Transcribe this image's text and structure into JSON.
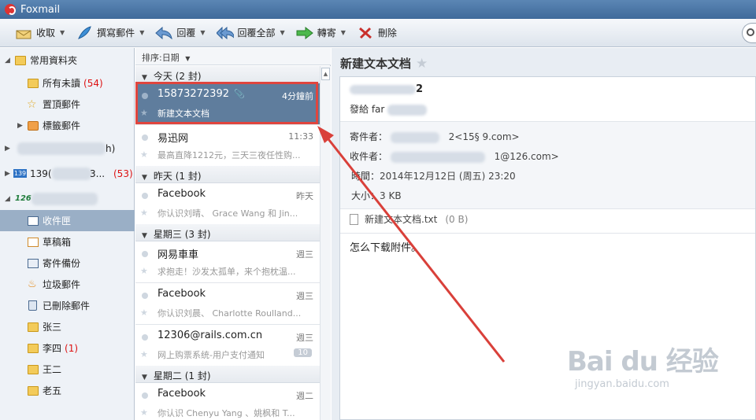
{
  "window": {
    "title": "Foxmail"
  },
  "toolbar": {
    "receive": "收取",
    "compose": "撰寫郵件",
    "reply": "回覆",
    "reply_all": "回覆全部",
    "forward": "轉寄",
    "delete": "刪除"
  },
  "sidebar": {
    "common_folder": "常用資料夾",
    "unread": "所有未讀",
    "unread_count": "(54)",
    "starred": "置頂郵件",
    "tags": "標籤郵件",
    "account1_suffix": "h)",
    "account2_prefix": "139(",
    "account2_mid": "3...",
    "account2_count": "(53)",
    "account3_prefix": "126",
    "inbox": "收件匣",
    "drafts": "草稿箱",
    "sent": "寄件備份",
    "junk": "垃圾郵件",
    "trash": "已刪除郵件",
    "folder_zhangsan": "张三",
    "folder_lisi": "李四",
    "folder_lisi_count": "(1)",
    "folder_wanger": "王二",
    "folder_laowu": "老五"
  },
  "list": {
    "sort_label": "排序:日期",
    "groups": [
      "今天 (2 封)",
      "昨天 (1 封)",
      "星期三 (3 封)",
      "星期二 (1 封)"
    ],
    "messages": [
      {
        "from": "15873272392",
        "time": "4分鐘前",
        "subject": "新建文本文档"
      },
      {
        "from": "易迅网",
        "time": "11:33",
        "subject": "最高直降1212元，三天三夜任性购..."
      },
      {
        "from": "Facebook",
        "time": "昨天",
        "subject": "你认识刘晴、 Grace Wang 和 Jin..."
      },
      {
        "from": "网易車車",
        "time": "週三",
        "subject": "求抱走！沙发太孤单，来个抱枕温..."
      },
      {
        "from": "Facebook",
        "time": "週三",
        "subject": "你认识刘晨、 Charlotte Roulland..."
      },
      {
        "from": "12306@rails.com.cn",
        "time": "週三",
        "subject": "网上购票系统-用户支付通知",
        "badge": "10"
      },
      {
        "from": "Facebook",
        "time": "週二",
        "subject": "你认识 Chenyu Yang 、姚枫和 T..."
      }
    ]
  },
  "reader": {
    "title": "新建文本文档",
    "from_name_suffix": "2",
    "send_by": "發給 far",
    "from_label": "寄件者：",
    "from_value": "2<15§                9.com>",
    "to_label": "收件者：",
    "to_value": "1@126.com>",
    "time_label": "時間：",
    "time_value": "2014年12月12日 (周五) 23:20",
    "size_label": "大小：",
    "size_value": "3 KB",
    "attachment_name": "新建文本文档.txt",
    "attachment_size": "(0 B)",
    "body": "怎么下载附件。"
  },
  "watermark": {
    "logo": "Bai du 经验",
    "url": "jingyan.baidu.com"
  },
  "colors": {
    "titlebar": "#4a76a6",
    "selection": "#5f7d9d",
    "highlight": "#e0453e",
    "unread_count": "#dd1111"
  }
}
